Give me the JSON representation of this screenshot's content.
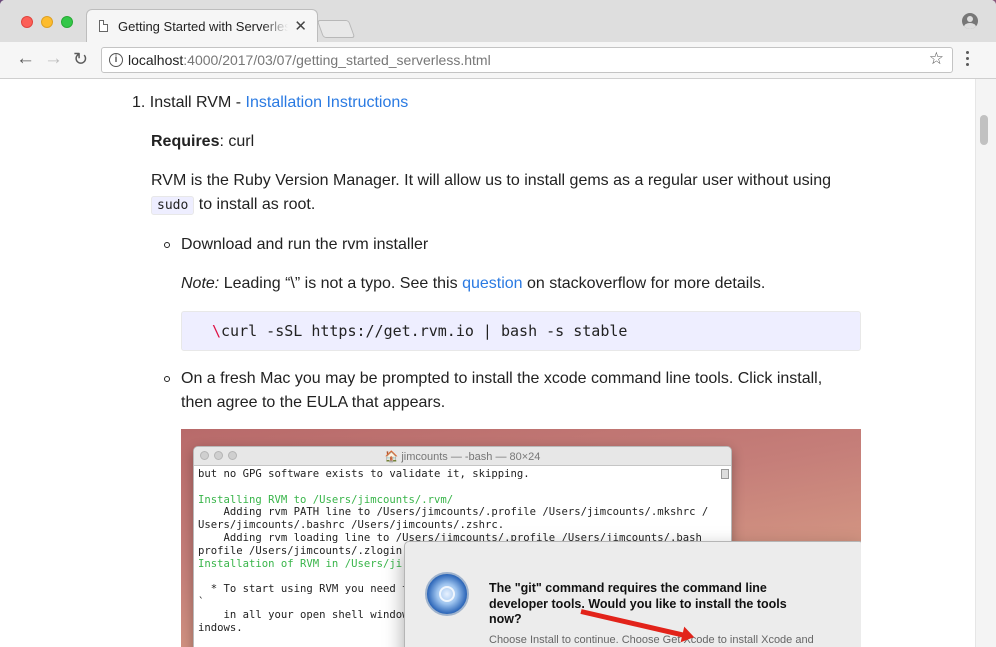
{
  "browser": {
    "tab": {
      "title": "Getting Started with Serverless",
      "close": "✕"
    },
    "url": {
      "host": "localhost",
      "path": ":4000/2017/03/07/getting_started_serverless.html"
    }
  },
  "article": {
    "item1": {
      "number": "1.",
      "text": "Install RVM - ",
      "link": "Installation Instructions"
    },
    "requires": {
      "label": "Requires",
      "value": ": curl"
    },
    "rvm_para": {
      "line1": "RVM is the Ruby Version Manager. It will allow us to install gems as a regular user without using",
      "code": "sudo",
      "line2": " to install as root."
    },
    "bullet1": "Download and run the rvm installer",
    "note": {
      "label": "Note:",
      "before": " Leading “\\” is not a typo. See this ",
      "link": "question",
      "after": " on stackoverflow for more details."
    },
    "code": {
      "escape": "\\",
      "text": "curl -sSL https://get.rvm.io | bash -s stable"
    },
    "bullet2": {
      "line1": "On a fresh Mac you may be prompted to install the xcode command line tools. Click install,",
      "line2": "then agree to the EULA that appears."
    }
  },
  "screenshot": {
    "terminal_title": "🏠 jimcounts — -bash — 80×24",
    "lines": [
      {
        "text": "but no GPG software exists to validate it, skipping.",
        "green": false
      },
      {
        "text": "",
        "green": false
      },
      {
        "text": "Installing RVM to /Users/jimcounts/.rvm/",
        "green": true
      },
      {
        "text": "    Adding rvm PATH line to /Users/jimcounts/.profile /Users/jimcounts/.mkshrc /",
        "green": false
      },
      {
        "text": "Users/jimcounts/.bashrc /Users/jimcounts/.zshrc.",
        "green": false
      },
      {
        "text": "    Adding rvm loading line to /Users/jimcounts/.profile /Users/jimcounts/.bash",
        "green": false
      },
      {
        "text": "profile /Users/jimcounts/.zlogin",
        "green": false
      },
      {
        "text": "Installation of RVM in /Users/ji",
        "green": true
      },
      {
        "text": "",
        "green": false
      },
      {
        "text": "  * To start using RVM you need t",
        "green": false
      },
      {
        "text": "`",
        "green": false
      },
      {
        "text": "    in all your open shell window",
        "green": false
      },
      {
        "text": "indows.",
        "green": false
      }
    ],
    "dialog": {
      "message": "The \"git\" command requires the command line developer tools. Would you like to install the tools now?",
      "sub": "Choose Install to continue. Choose Get Xcode to install Xcode and"
    }
  }
}
